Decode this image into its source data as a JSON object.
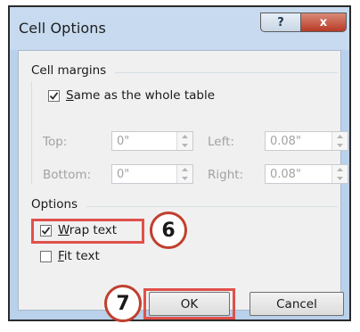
{
  "window": {
    "title": "Cell Options",
    "help_glyph": "?",
    "close_glyph": "x"
  },
  "cell_margins": {
    "group_label": "Cell margins",
    "same_as_table": {
      "label_accel": "S",
      "label_rest": "ame as the whole table",
      "checked": true
    },
    "top": {
      "label": "Top:",
      "value": "0\""
    },
    "left": {
      "label": "Left:",
      "value": "0.08\""
    },
    "bottom": {
      "label": "Bottom:",
      "value": "0\""
    },
    "right": {
      "label": "Right:",
      "value": "0.08\""
    }
  },
  "options": {
    "group_label": "Options",
    "wrap_text": {
      "label_accel": "W",
      "label_rest": "rap text",
      "checked": true
    },
    "fit_text": {
      "label_accel": "F",
      "label_rest": "it text",
      "checked": false
    }
  },
  "buttons": {
    "ok": "OK",
    "cancel": "Cancel"
  },
  "annotations": {
    "step_wrap": "6",
    "step_ok": "7",
    "highlight_color": "#e0504a",
    "circle_border_color": "#c13f2f"
  },
  "colors": {
    "titlebar": "#c7daef",
    "close_button": "#c44a36",
    "dialog_face": "#f0f0f0",
    "disabled_text": "#a2a2a2"
  }
}
